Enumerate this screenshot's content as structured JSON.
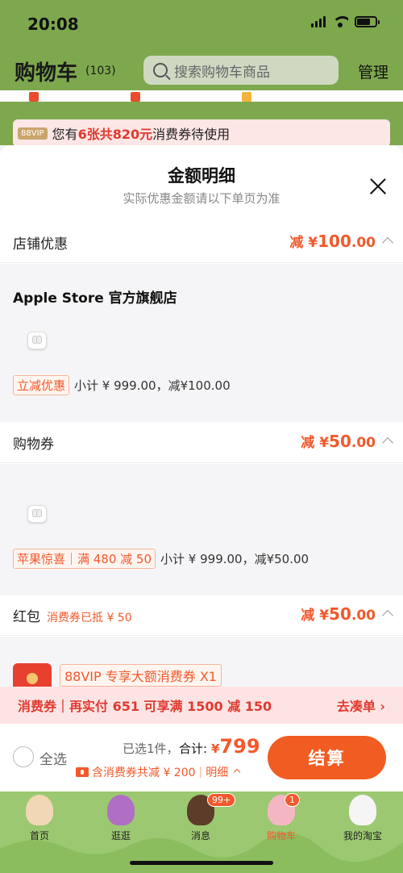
{
  "status_bar": {
    "time": "20:08"
  },
  "header": {
    "title": "购物车",
    "count": "(103)",
    "search_placeholder": "搜索购物车商品",
    "manage": "管理"
  },
  "vip_banner": {
    "tag": "88VIP",
    "prefix": "您有",
    "highlight": "6张共820元",
    "suffix": "消费券待使用"
  },
  "modal": {
    "title": "金额明细",
    "subtitle": "实际优惠金额请以下单页为准",
    "sections": {
      "store": {
        "label": "店铺优惠",
        "amount_prefix": "减 ¥",
        "amount_main": "100",
        "amount_decimal": ".00",
        "store_name": "Apple Store 官方旗舰店",
        "promo_tag": "立减优惠",
        "promo_desc": "小计 ¥ 999.00，减¥100.00"
      },
      "coupon": {
        "label": "购物券",
        "amount_prefix": "减 ¥",
        "amount_main": "50",
        "amount_decimal": ".00",
        "promo_tag": "苹果惊喜｜满 480 减 50",
        "promo_desc": "小计 ¥ 999.00，减¥50.00"
      },
      "redpacket": {
        "label": "红包",
        "note": "消费券已抵 ¥ 50",
        "amount_prefix": "减 ¥",
        "amount_main": "50",
        "amount_decimal": ".00",
        "coupon_title": "88VIP 专享大额消费券 X1"
      }
    }
  },
  "coupon_bar": {
    "text": "消费券｜再实付 651 可享满 1500 减 150",
    "action": "去凑单 ›"
  },
  "checkout": {
    "select_all": "全选",
    "selected": "已选1件，",
    "total_label": "合计:",
    "currency": "¥",
    "total": "799",
    "coupon_note": "含消费券共减 ¥ 200",
    "detail": "明细",
    "button": "结算"
  },
  "tabs": [
    {
      "label": "首页",
      "active": false
    },
    {
      "label": "逛逛",
      "active": false
    },
    {
      "label": "消息",
      "badge": "99+",
      "active": false
    },
    {
      "label": "购物车",
      "badge": "1",
      "active": true
    },
    {
      "label": "我的淘宝",
      "active": false
    }
  ],
  "colors": {
    "accent": "#f2592c",
    "header_bg": "#7ea84e",
    "tabbar_bg": "#9cc871"
  }
}
